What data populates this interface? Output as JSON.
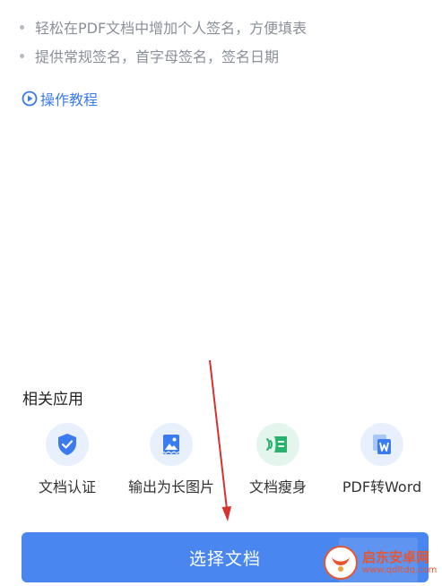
{
  "features": [
    "轻松在PDF文档中增加个人签名，方便填表",
    "提供常规签名，首字母签名，签名日期"
  ],
  "tutorial": {
    "label": "操作教程"
  },
  "related": {
    "title": "相关应用",
    "apps": [
      {
        "label": "文档认证",
        "icon": "shield-check-icon",
        "bg": "#e8f0fd",
        "fg": "#3a7bf0"
      },
      {
        "label": "输出为长图片",
        "icon": "long-image-icon",
        "bg": "#e8f0fd",
        "fg": "#3a7bf0"
      },
      {
        "label": "文档瘦身",
        "icon": "compress-icon",
        "bg": "#e3f5ec",
        "fg": "#27b36b"
      },
      {
        "label": "PDF转Word",
        "icon": "pdf-to-word-icon",
        "bg": "#e8f0fd",
        "fg": "#3a7bf0"
      }
    ]
  },
  "primary_button": {
    "label": "选择文档"
  },
  "watermark": {
    "title": "启东安卓网",
    "url": "www.qdltdq.com"
  },
  "colors": {
    "accent": "#4a86f0",
    "annotation": "#d93030"
  }
}
